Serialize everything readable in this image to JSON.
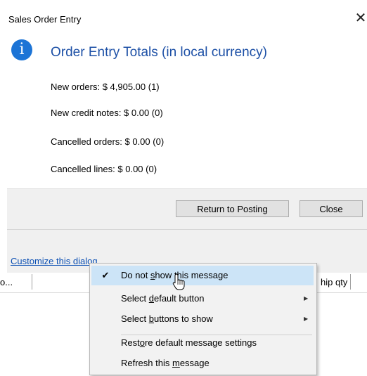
{
  "dialog": {
    "title": "Sales Order Entry",
    "close_glyph": "✕",
    "info_icon": "info-icon",
    "info_letter": "i",
    "heading": "Order Entry Totals (in local currency)",
    "stats": [
      "New orders: $ 4,905.00 (1)",
      "New credit notes: $ 0.00 (0)",
      "Cancelled orders: $ 0.00 (0)",
      "Cancelled lines: $ 0.00 (0)"
    ],
    "buttons": {
      "return_label": "Return to Posting",
      "close_label": "Close"
    },
    "customize_link": "Customize this dialog"
  },
  "grid": {
    "left_header": "o...",
    "right_header": "hip qty"
  },
  "context_menu": {
    "items": [
      {
        "prefix": "Do not ",
        "mnemonic": "s",
        "suffix": "how this message",
        "checked": true,
        "submenu": false,
        "highlighted": true
      },
      {
        "prefix": "Select ",
        "mnemonic": "d",
        "suffix": "efault button",
        "checked": false,
        "submenu": true,
        "highlighted": false
      },
      {
        "prefix": "Select ",
        "mnemonic": "b",
        "suffix": "uttons to show",
        "checked": false,
        "submenu": true,
        "highlighted": false
      },
      {
        "prefix": "Rest",
        "mnemonic": "o",
        "suffix": "re default message settings",
        "checked": false,
        "submenu": false,
        "highlighted": false
      },
      {
        "prefix": "Refresh this ",
        "mnemonic": "m",
        "suffix": "essage",
        "checked": false,
        "submenu": false,
        "highlighted": false
      }
    ],
    "check_glyph": "✔",
    "submenu_glyph": "▶"
  },
  "colors": {
    "accent_heading": "#1d50a6",
    "info_icon_bg": "#1c74d6",
    "menu_highlight": "#cce4f7",
    "link": "#0b4fb3"
  }
}
